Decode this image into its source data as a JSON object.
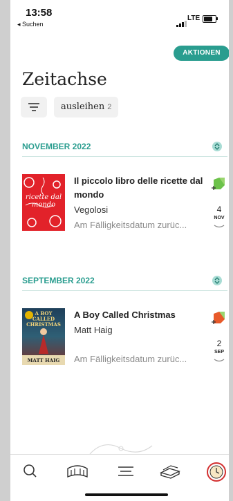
{
  "status_bar": {
    "time": "13:58",
    "back_app": "◂ Suchen",
    "network": "LTE"
  },
  "header": {
    "actions_label": "AKTIONEN",
    "title": "Zeitachse"
  },
  "filter": {
    "chip_label": "ausleihen",
    "chip_count": "2"
  },
  "sections": [
    {
      "title": "NOVEMBER 2022",
      "books": [
        {
          "title": "Il piccolo libro delle ricette dal mondo",
          "author": "Vegolosi",
          "status": "Am Fälligkeitsdatum zurüc...",
          "day": "4",
          "month": "NOV",
          "cover_text": "ricette dal mondo"
        }
      ]
    },
    {
      "title": "SEPTEMBER 2022",
      "books": [
        {
          "title": "A Boy Called Christmas",
          "author": "Matt Haig",
          "status": "Am Fälligkeitsdatum zurüc...",
          "day": "2",
          "month": "SEP",
          "cover_text": "A BOY CALLED CHRISTMAS",
          "cover_author": "MATT HAIG"
        }
      ]
    }
  ],
  "tabs": [
    {
      "name": "search-tab",
      "icon": "search-icon"
    },
    {
      "name": "library-tab",
      "icon": "books-icon"
    },
    {
      "name": "menu-tab",
      "icon": "menu-icon"
    },
    {
      "name": "shelf-tab",
      "icon": "book-stack-icon"
    },
    {
      "name": "timeline-tab",
      "icon": "clock-icon",
      "active": true
    }
  ],
  "colors": {
    "accent": "#2a9d8f",
    "active_tab": "#d32f2f"
  }
}
